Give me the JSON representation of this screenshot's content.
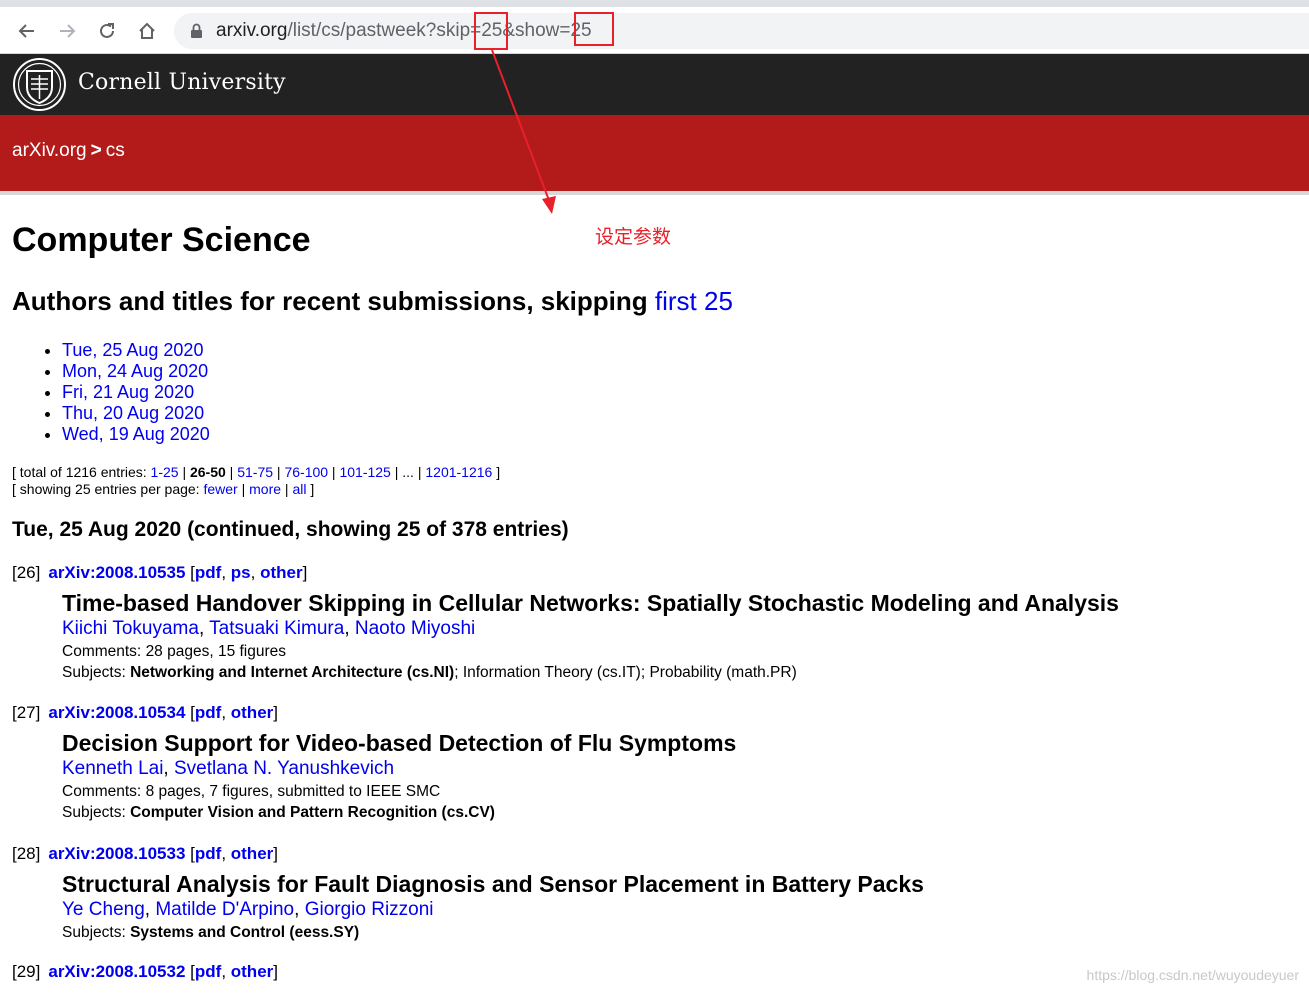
{
  "browser": {
    "url_host": "arxiv.org",
    "url_path": "/list/cs/pastweek?skip=25&show=25"
  },
  "banner": {
    "institution": "Cornell University"
  },
  "header": {
    "crumb_site": "arXiv.org",
    "crumb_sep": ">",
    "crumb_section": "cs"
  },
  "page": {
    "title": "Computer Science",
    "subtitle_text": "Authors and titles for recent submissions, skipping",
    "subtitle_link": "first 25",
    "dates": [
      "Tue, 25 Aug 2020",
      "Mon, 24 Aug 2020",
      "Fri, 21 Aug 2020",
      "Thu, 20 Aug 2020",
      "Wed, 19 Aug 2020"
    ]
  },
  "paging": {
    "total_prefix": "[ total of 1216 entries:",
    "ranges": [
      "1-25",
      "26-50",
      "51-75",
      "76-100",
      "101-125",
      "...",
      "1201-1216"
    ],
    "current": "26-50",
    "total_suffix": "]",
    "showing_prefix": "[ showing 25 entries per page:",
    "fewer": "fewer",
    "more": "more",
    "all": "all",
    "showing_suffix": "]"
  },
  "section_heading": "Tue, 25 Aug 2020 (continued, showing 25 of 378 entries)",
  "entries": [
    {
      "index": "[26]",
      "arxiv_id": "arXiv:2008.10535",
      "formats": [
        "pdf",
        "ps",
        "other"
      ],
      "title": "Time-based Handover Skipping in Cellular Networks: Spatially Stochastic Modeling and Analysis",
      "authors": [
        "Kiichi Tokuyama",
        "Tatsuaki Kimura",
        "Naoto Miyoshi"
      ],
      "comments_label": "Comments:",
      "comments": "28 pages, 15 figures",
      "subjects_label": "Subjects:",
      "subject_primary": "Networking and Internet Architecture (cs.NI)",
      "subject_rest": "; Information Theory (cs.IT); Probability (math.PR)"
    },
    {
      "index": "[27]",
      "arxiv_id": "arXiv:2008.10534",
      "formats": [
        "pdf",
        "other"
      ],
      "title": "Decision Support for Video-based Detection of Flu Symptoms",
      "authors": [
        "Kenneth Lai",
        "Svetlana N. Yanushkevich"
      ],
      "comments_label": "Comments:",
      "comments": "8 pages, 7 figures, submitted to IEEE SMC",
      "subjects_label": "Subjects:",
      "subject_primary": "Computer Vision and Pattern Recognition (cs.CV)",
      "subject_rest": ""
    },
    {
      "index": "[28]",
      "arxiv_id": "arXiv:2008.10533",
      "formats": [
        "pdf",
        "other"
      ],
      "title": "Structural Analysis for Fault Diagnosis and Sensor Placement in Battery Packs",
      "authors": [
        "Ye Cheng",
        "Matilde D'Arpino",
        "Giorgio Rizzoni"
      ],
      "subjects_label": "Subjects:",
      "subject_primary": "Systems and Control (eess.SY)",
      "subject_rest": ""
    },
    {
      "index": "[29]",
      "arxiv_id": "arXiv:2008.10532",
      "formats": [
        "pdf",
        "other"
      ]
    }
  ],
  "annotation": {
    "note": "设定参数",
    "color": "#e8202a"
  },
  "watermark": "https://blog.csdn.net/wuyoudeyuer",
  "colors": {
    "arxiv_red": "#b31b1b",
    "cornell_black": "#222222",
    "link_blue": "#0000ee"
  }
}
